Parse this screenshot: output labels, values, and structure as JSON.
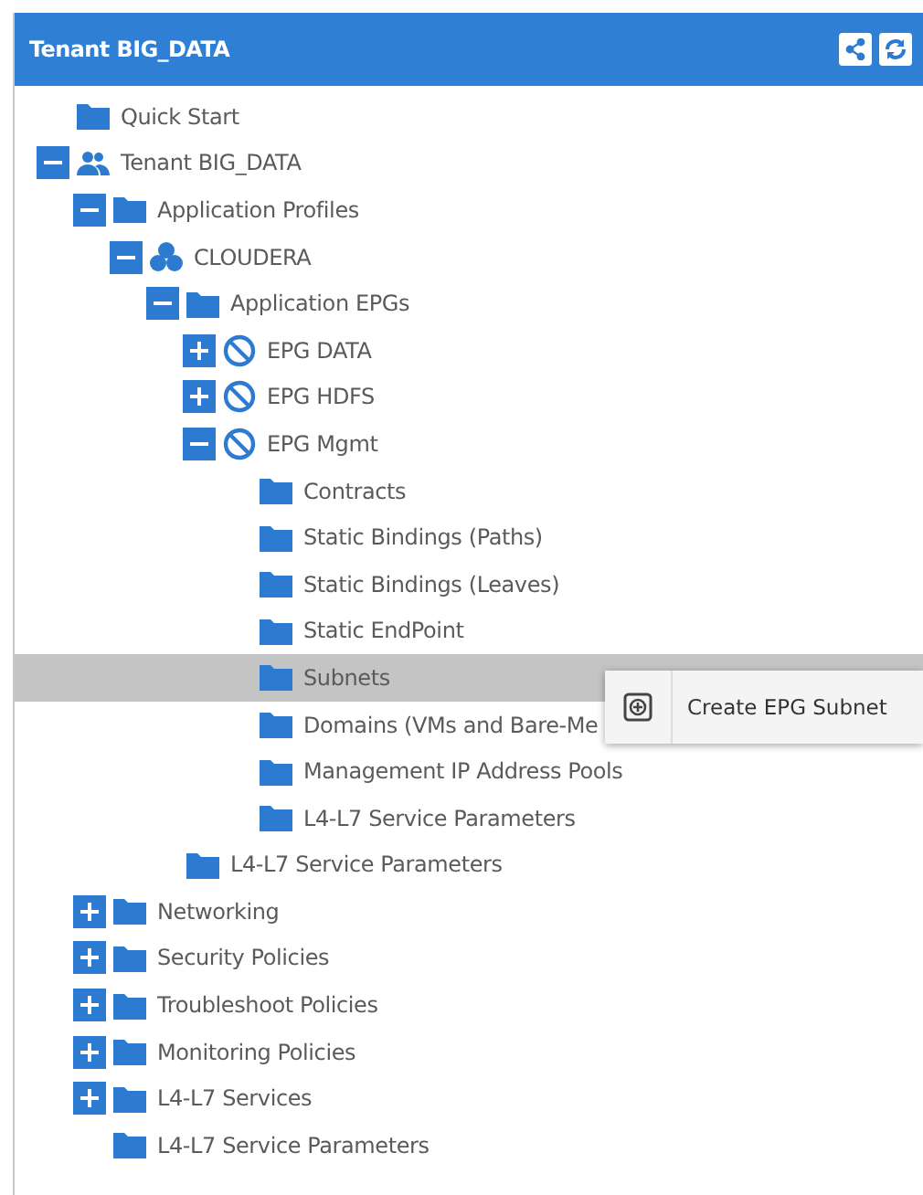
{
  "panel": {
    "title": "Tenant BIG_DATA"
  },
  "tree": [
    {
      "label": "Quick Start",
      "kind": "folder",
      "selected": false
    },
    {
      "label": "Tenant BIG_DATA",
      "kind": "tenant",
      "selected": false,
      "expanded": true,
      "children": [
        {
          "label": "Application Profiles",
          "kind": "folder",
          "selected": false,
          "expanded": true,
          "children": [
            {
              "label": "CLOUDERA",
              "kind": "app",
              "selected": false,
              "expanded": true,
              "children": [
                {
                  "label": "Application EPGs",
                  "kind": "folder",
                  "selected": false,
                  "expanded": true,
                  "children": [
                    {
                      "label": "EPG DATA",
                      "kind": "epg",
                      "selected": false,
                      "expanded": false
                    },
                    {
                      "label": "EPG HDFS",
                      "kind": "epg",
                      "selected": false,
                      "expanded": false
                    },
                    {
                      "label": "EPG Mgmt",
                      "kind": "epg",
                      "selected": false,
                      "expanded": true,
                      "children": [
                        {
                          "label": "Contracts",
                          "kind": "folder",
                          "selected": false
                        },
                        {
                          "label": "Static Bindings (Paths)",
                          "kind": "folder",
                          "selected": false
                        },
                        {
                          "label": "Static Bindings (Leaves)",
                          "kind": "folder",
                          "selected": false
                        },
                        {
                          "label": "Static EndPoint",
                          "kind": "folder",
                          "selected": false
                        },
                        {
                          "label": "Subnets",
                          "kind": "folder",
                          "selected": true
                        },
                        {
                          "label": "Domains (VMs and Bare-Me",
                          "kind": "folder",
                          "selected": false
                        },
                        {
                          "label": "Management IP Address Pools",
                          "kind": "folder",
                          "selected": false
                        },
                        {
                          "label": "L4-L7 Service Parameters",
                          "kind": "folder",
                          "selected": false
                        }
                      ]
                    }
                  ]
                },
                {
                  "label": "L4-L7 Service Parameters",
                  "kind": "folder",
                  "selected": false
                }
              ]
            }
          ]
        },
        {
          "label": "Networking",
          "kind": "folder",
          "selected": false,
          "expanded": false
        },
        {
          "label": "Security Policies",
          "kind": "folder",
          "selected": false,
          "expanded": false
        },
        {
          "label": "Troubleshoot Policies",
          "kind": "folder",
          "selected": false,
          "expanded": false
        },
        {
          "label": "Monitoring Policies",
          "kind": "folder",
          "selected": false,
          "expanded": false
        },
        {
          "label": "L4-L7 Services",
          "kind": "folder",
          "selected": false,
          "expanded": false
        },
        {
          "label": "L4-L7 Service Parameters",
          "kind": "folder",
          "selected": false
        }
      ]
    }
  ],
  "context_menu": {
    "items": [
      {
        "label": "Create EPG Subnet"
      }
    ]
  }
}
